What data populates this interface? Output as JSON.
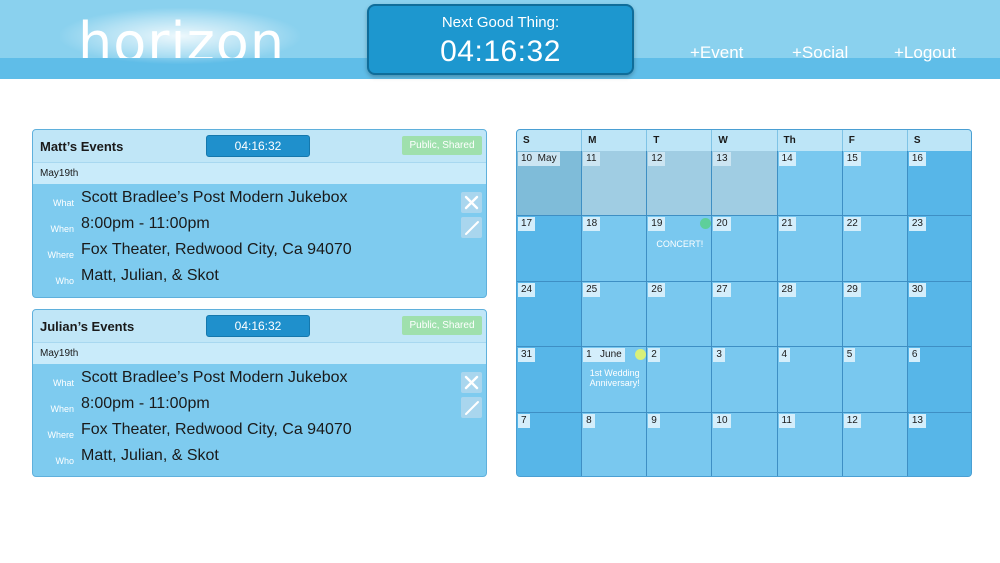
{
  "header": {
    "logo": "horizon",
    "countdown_label": "Next Good Thing:",
    "countdown_time": "04:16:32",
    "nav": [
      "+Event",
      "+Social",
      "+Logout"
    ]
  },
  "cards": [
    {
      "title": "Matt’s Events",
      "timer": "04:16:32",
      "badge": "Public, Shared",
      "date": "May19th",
      "rows": [
        {
          "key": "What",
          "value": "Scott Bradlee’s Post Modern Jukebox"
        },
        {
          "key": "When",
          "value": "8:00pm - 11:00pm"
        },
        {
          "key": "Where",
          "value": "Fox Theater, Redwood City, Ca 94070"
        },
        {
          "key": "Who",
          "value": "Matt, Julian, & Skot"
        }
      ]
    },
    {
      "title": "Julian’s Events",
      "timer": "04:16:32",
      "badge": "Public, Shared",
      "date": "May19th",
      "rows": [
        {
          "key": "What",
          "value": "Scott Bradlee’s Post Modern Jukebox"
        },
        {
          "key": "When",
          "value": "8:00pm - 11:00pm"
        },
        {
          "key": "Where",
          "value": "Fox Theater, Redwood City, Ca 94070"
        },
        {
          "key": "Who",
          "value": "Matt, Julian, & Skot"
        }
      ]
    }
  ],
  "calendar": {
    "weekdays": [
      "S",
      "M",
      "T",
      "W",
      "Th",
      "F",
      "S"
    ],
    "weeks": [
      [
        "10  May",
        "11",
        "12",
        "13",
        "14",
        "15",
        "16"
      ],
      [
        "17",
        "18",
        "19",
        "20",
        "21",
        "22",
        "23"
      ],
      [
        "24",
        "25",
        "26",
        "27",
        "28",
        "29",
        "30"
      ],
      [
        "31",
        "1   June",
        "2",
        "3",
        "4",
        "5",
        "6"
      ],
      [
        "7",
        "8",
        "9",
        "10",
        "11",
        "12",
        "13"
      ]
    ],
    "past_days": 4,
    "events": [
      {
        "week": 1,
        "day": 2,
        "label": "CONCERT!",
        "dot_color": "#5ecf9a"
      },
      {
        "week": 3,
        "day": 1,
        "label": "1st Wedding Anniversary!",
        "dot_color": "#d8f07a"
      }
    ]
  },
  "colors": {
    "accent": "#1d97cf",
    "header": "#8ad1ee",
    "badge": "#9fe0ad"
  }
}
